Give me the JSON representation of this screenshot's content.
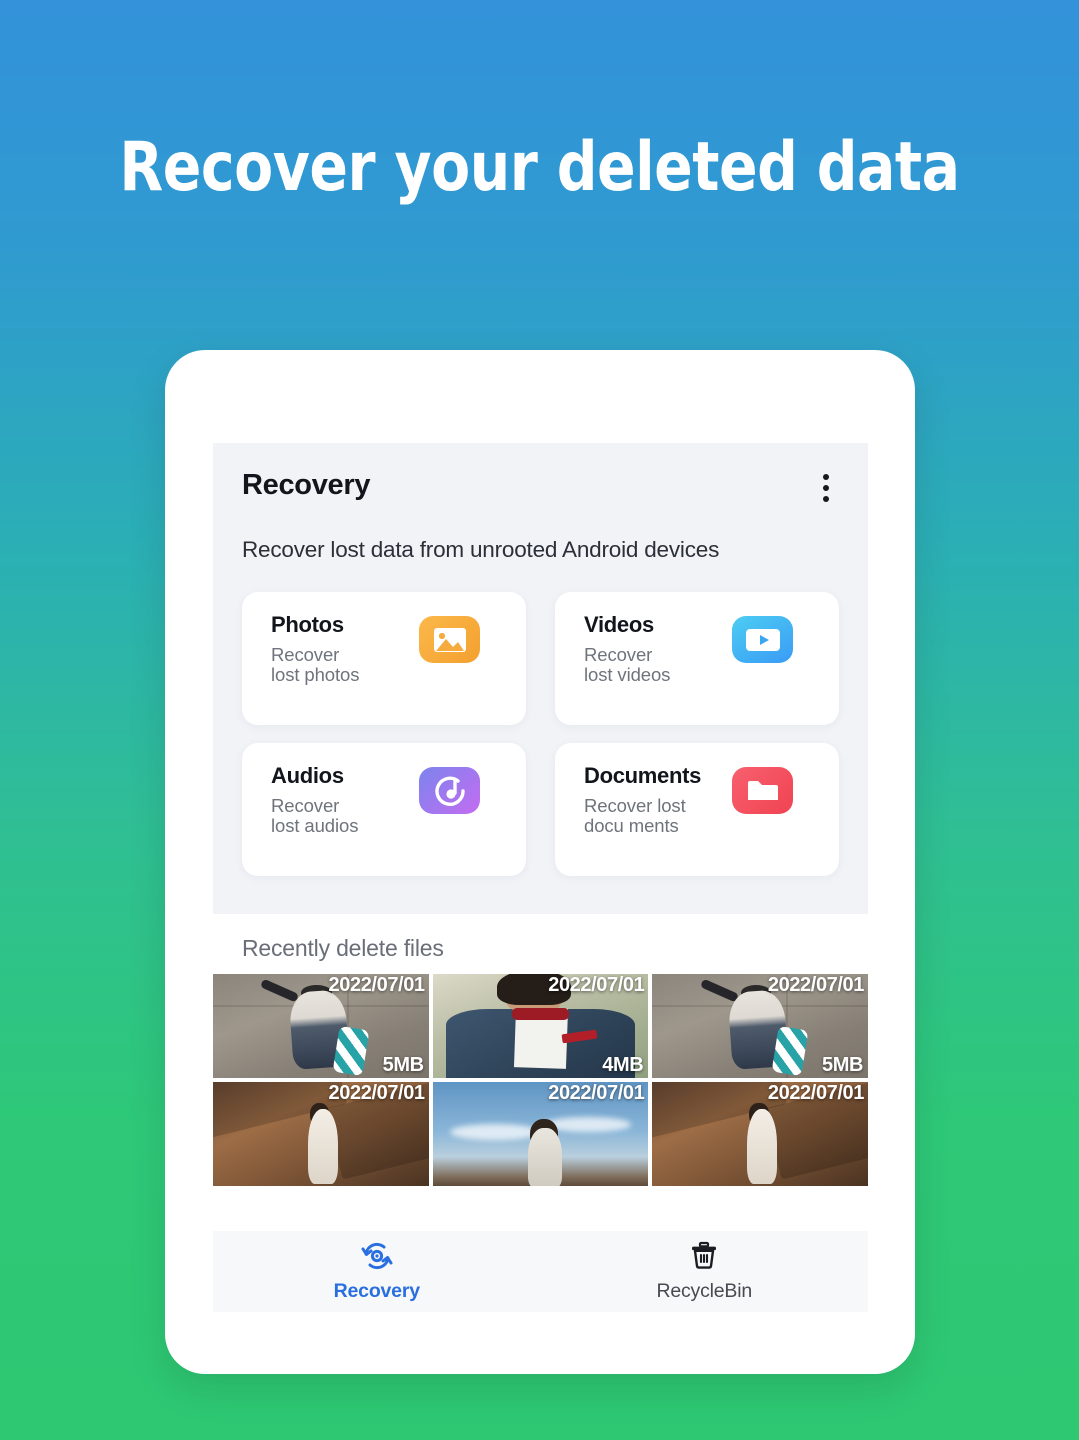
{
  "promo": {
    "headline": "Recover your deleted data",
    "bg_top_color": "#3392da",
    "bg_bottom_color": "#2ec872"
  },
  "app": {
    "header": {
      "title": "Recovery",
      "menu_icon": "kebab-menu-icon",
      "subtitle": "Recover lost data from unrooted Android devices"
    },
    "features": [
      {
        "title": "Photos",
        "desc": "Recover lost photos",
        "icon": "image-icon",
        "color": "#f5ab3d"
      },
      {
        "title": "Videos",
        "desc": "Recover lost videos",
        "icon": "video-icon",
        "color": "#45b6f3"
      },
      {
        "title": "Audios",
        "desc": "Recover lost audios",
        "icon": "music-icon",
        "color": "#a878f0"
      },
      {
        "title": "Documents",
        "desc": "Recover lost docu ments",
        "icon": "folder-icon",
        "color": "#f4505e"
      }
    ],
    "recent": {
      "title": "Recently delete files",
      "items": [
        {
          "date": "2022/07/01",
          "size": "5MB",
          "scene": "skater"
        },
        {
          "date": "2022/07/01",
          "size": "4MB",
          "scene": "suit"
        },
        {
          "date": "2022/07/01",
          "size": "5MB",
          "scene": "skater"
        },
        {
          "date": "2022/07/01",
          "size": "",
          "scene": "canyon"
        },
        {
          "date": "2022/07/01",
          "size": "",
          "scene": "sky"
        },
        {
          "date": "2022/07/01",
          "size": "",
          "scene": "canyon"
        }
      ]
    },
    "bottom_nav": {
      "active_color": "#2a6fe0",
      "inactive_color": "#474a52",
      "items": [
        {
          "label": "Recovery",
          "icon": "recovery-refresh-icon",
          "active": true
        },
        {
          "label": "RecycleBin",
          "icon": "trash-icon",
          "active": false
        }
      ]
    }
  }
}
